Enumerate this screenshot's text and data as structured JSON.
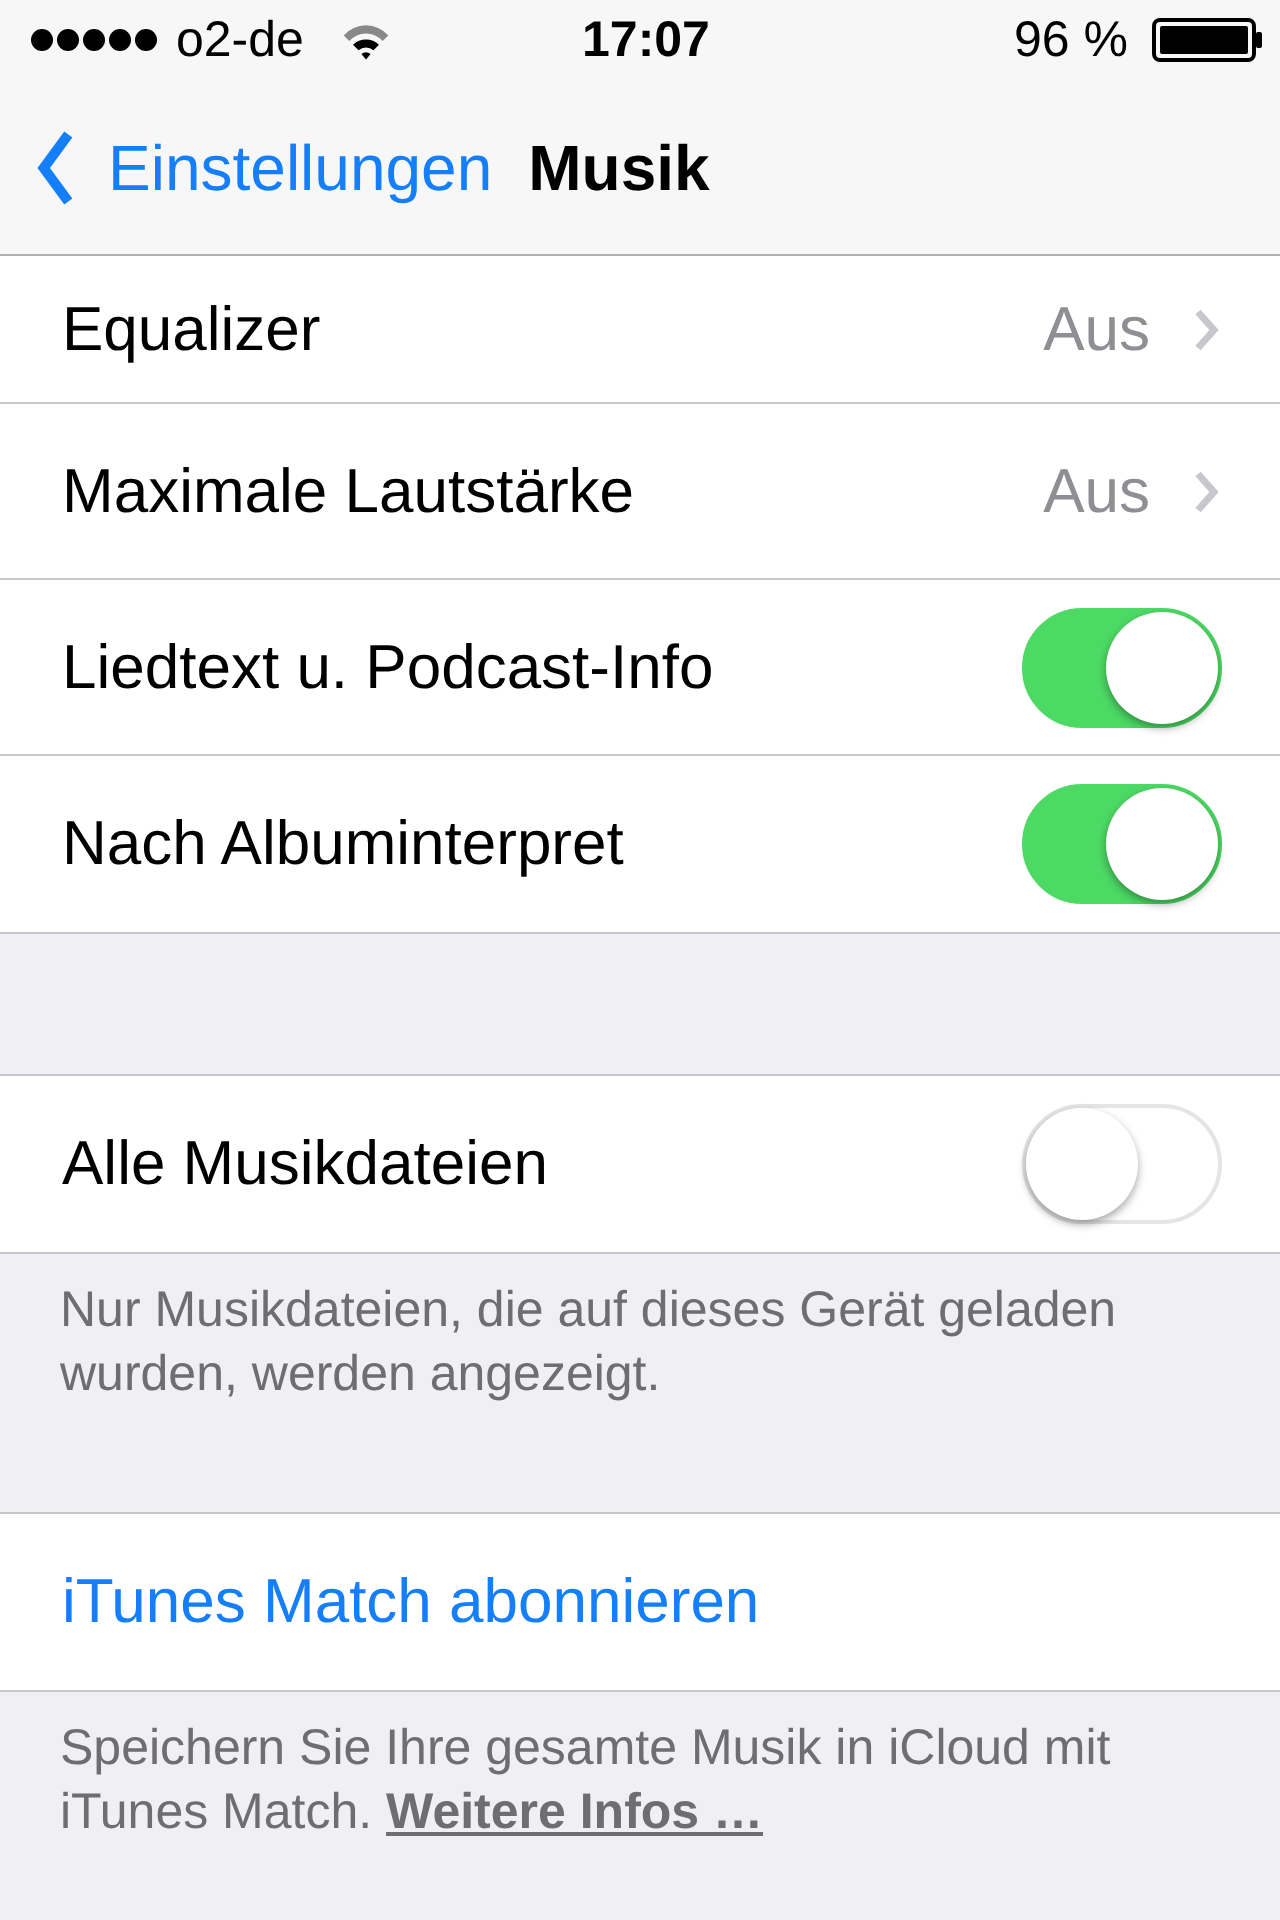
{
  "status_bar": {
    "carrier": "o2-de",
    "time": "17:07",
    "battery": "96 %"
  },
  "nav": {
    "back": "Einstellungen",
    "title": "Musik"
  },
  "groups": [
    {
      "rows": [
        {
          "kind": "disclosure",
          "label": "Equalizer",
          "value": "Aus"
        },
        {
          "kind": "disclosure",
          "label": "Maximale Lautstärke",
          "value": "Aus"
        },
        {
          "kind": "toggle",
          "label": "Liedtext u. Podcast-Info",
          "on": true
        },
        {
          "kind": "toggle",
          "label": "Nach Albuminterpret",
          "on": true
        }
      ]
    },
    {
      "rows": [
        {
          "kind": "toggle",
          "label": "Alle Musikdateien",
          "on": false
        }
      ],
      "footer": {
        "text": "Nur Musikdateien, die auf dieses Gerät geladen wurden, werden angezeigt."
      }
    },
    {
      "rows": [
        {
          "kind": "action",
          "label": "iTunes Match abonnieren"
        }
      ],
      "footer": {
        "text": "Speichern Sie Ihre gesamte Musik in iCloud mit iTunes Match.",
        "link": "Weitere Infos …"
      }
    }
  ]
}
